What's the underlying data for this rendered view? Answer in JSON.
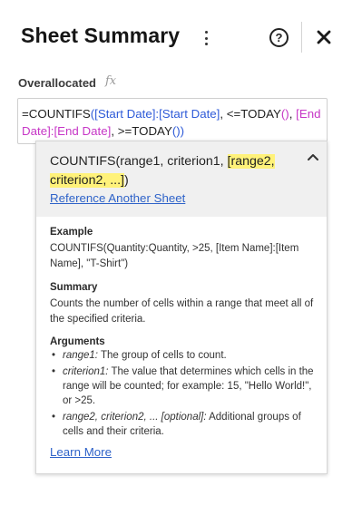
{
  "header": {
    "title": "Sheet Summary",
    "menu_icon": "kebab-menu-icon",
    "help_icon": "question-circle-icon",
    "help_glyph": "?",
    "close_icon": "close-icon"
  },
  "field": {
    "label": "Overallocated",
    "fx_icon": "fx"
  },
  "formula": {
    "tokens": [
      {
        "text": "=COUNTIFS",
        "kind": "fn"
      },
      {
        "text": "(",
        "kind": "paren-a"
      },
      {
        "text": "[Start Date]:[Start Date]",
        "kind": "ref-a"
      },
      {
        "text": ", <=TODAY",
        "kind": "fn"
      },
      {
        "text": "()",
        "kind": "paren-b"
      },
      {
        "text": ", ",
        "kind": "fn"
      },
      {
        "text": "[End Date]:[End Date]",
        "kind": "ref-b"
      },
      {
        "text": ", >=TODAY",
        "kind": "fn"
      },
      {
        "text": "())",
        "kind": "paren-a"
      }
    ]
  },
  "help_popup": {
    "signature_plain": "COUNTIFS(range1, criterion1, ",
    "signature_highlight": "[range2, criterion2, ...]",
    "signature_end": ")",
    "reference_link": "Reference Another Sheet",
    "example_title": "Example",
    "example_body": "COUNTIFS(Quantity:Quantity, >25, [Item Name]:[Item Name], \"T-Shirt\")",
    "summary_title": "Summary",
    "summary_body": "Counts the number of cells within a range that meet all of the specified criteria.",
    "arguments_title": "Arguments",
    "arguments": [
      {
        "name": "range1:",
        "desc": " The group of cells to count."
      },
      {
        "name": "criterion1:",
        "desc": " The value that determines which cells in the range will be counted; for example: 15, \"Hello World!\", or >25."
      },
      {
        "name": "range2, criterion2, ... [optional]:",
        "desc": " Additional groups of cells and their criteria."
      }
    ],
    "learn_more": "Learn More"
  },
  "colors": {
    "ref_blue": "#2f5bd8",
    "ref_magenta": "#c636c6",
    "link_blue": "#2f63c9",
    "highlight": "#fff27a"
  }
}
